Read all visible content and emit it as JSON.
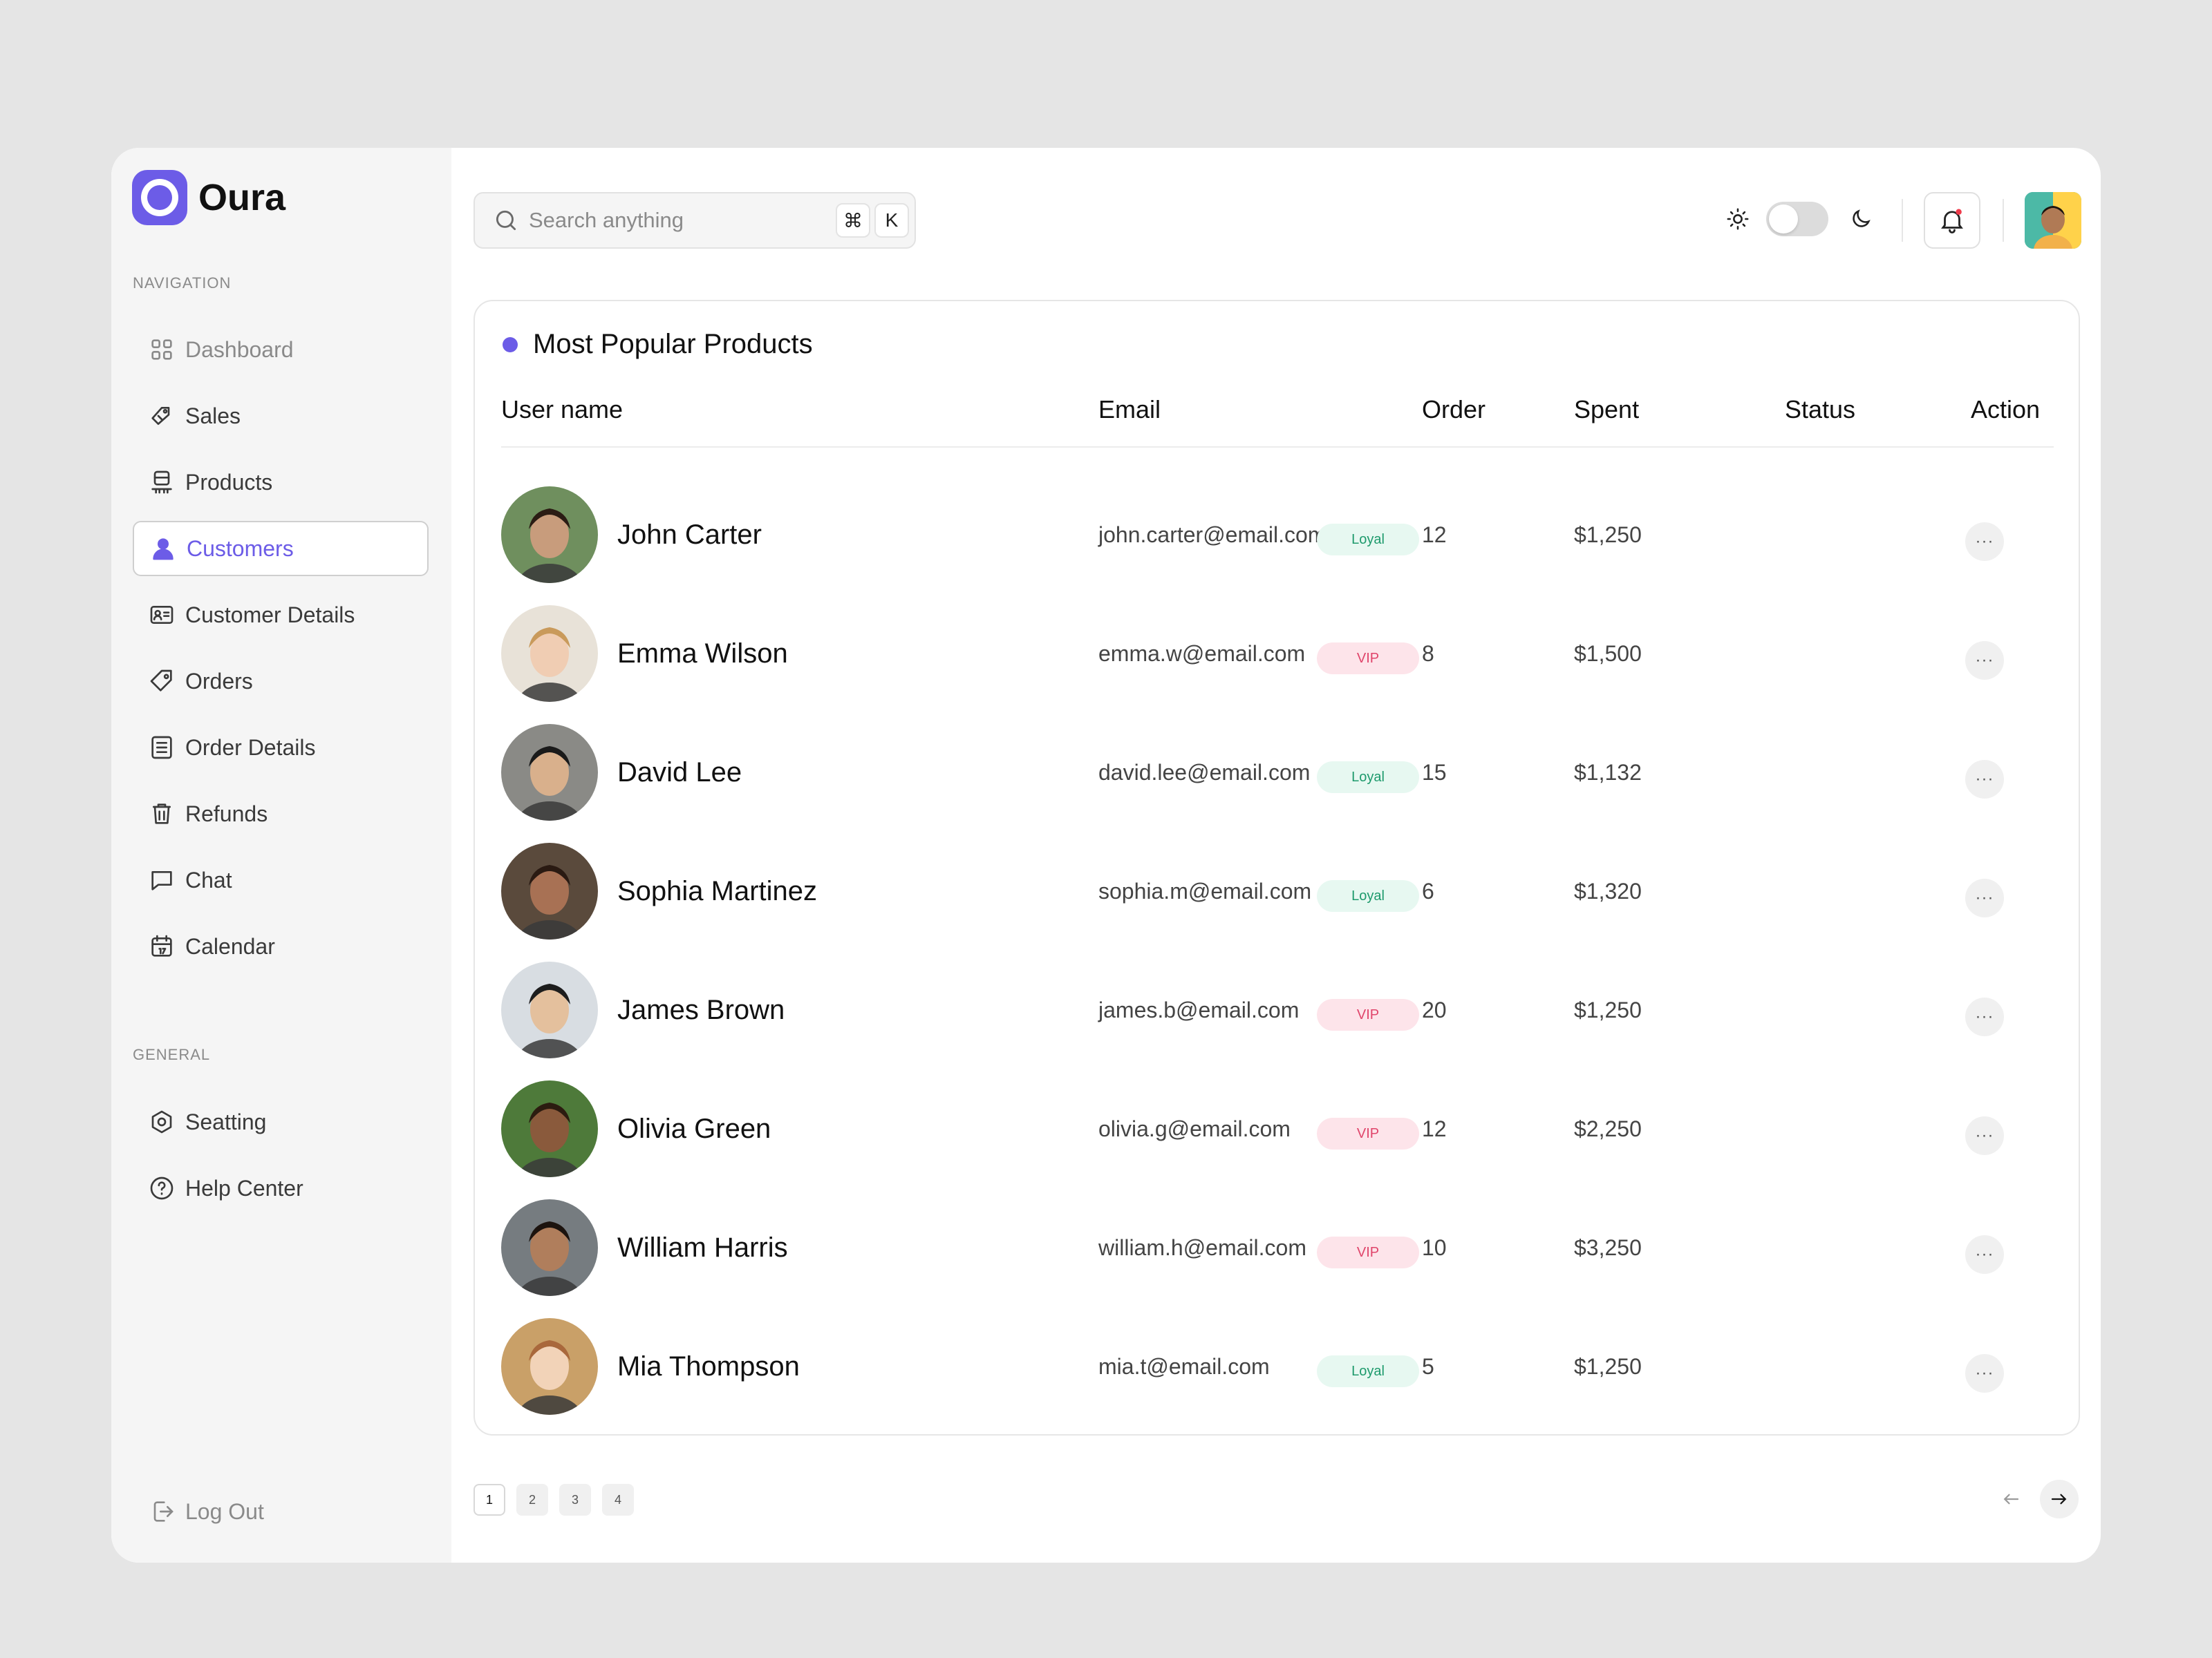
{
  "app": {
    "brand": "Oura"
  },
  "sidebar": {
    "navigation_label": "NAVIGATION",
    "nav_items": [
      {
        "label": "Dashboard",
        "icon": "grid-icon",
        "state": "muted"
      },
      {
        "label": "Sales",
        "icon": "tag-icon",
        "state": ""
      },
      {
        "label": "Products",
        "icon": "box-icon",
        "state": ""
      },
      {
        "label": "Customers",
        "icon": "user-icon",
        "state": "active"
      },
      {
        "label": "Customer Details",
        "icon": "id-card-icon",
        "state": ""
      },
      {
        "label": "Orders",
        "icon": "price-tag-icon",
        "state": ""
      },
      {
        "label": "Order Details",
        "icon": "list-icon",
        "state": ""
      },
      {
        "label": "Refunds",
        "icon": "trash-icon",
        "state": ""
      },
      {
        "label": "Chat",
        "icon": "chat-icon",
        "state": ""
      },
      {
        "label": "Calendar",
        "icon": "calendar-icon",
        "state": ""
      }
    ],
    "general_label": "GENERAL",
    "general_items": [
      {
        "label": "Seatting",
        "icon": "settings-icon"
      },
      {
        "label": "Help Center",
        "icon": "help-icon"
      }
    ],
    "logout_label": "Log Out"
  },
  "topbar": {
    "search_placeholder": "Search anything",
    "shortcut_cmd": "⌘",
    "shortcut_key": "K"
  },
  "table": {
    "title": "Most Popular Products",
    "columns": {
      "user": "User name",
      "email": "Email",
      "order": "Order",
      "spent": "Spent",
      "status": "Status",
      "action": "Action"
    },
    "rows": [
      {
        "name": "John Carter",
        "email": "john.carter@email.com",
        "order": "12",
        "spent": "$1,250",
        "status": "Loyal",
        "tone": "loyal",
        "skin": "#c89c7c",
        "hair": "#2b1c14",
        "bg": "#6f8f5e"
      },
      {
        "name": "Emma Wilson",
        "email": "emma.w@email.com",
        "order": "8",
        "spent": "$1,500",
        "status": "VIP",
        "tone": "vip",
        "skin": "#f0cdb3",
        "hair": "#c99a5b",
        "bg": "#e8e2d8"
      },
      {
        "name": "David Lee",
        "email": "david.lee@email.com",
        "order": "15",
        "spent": "$1,132",
        "status": "Loyal",
        "tone": "loyal",
        "skin": "#d9b08c",
        "hair": "#1a1a1a",
        "bg": "#8a8a86"
      },
      {
        "name": "Sophia Martinez",
        "email": "sophia.m@email.com",
        "order": "6",
        "spent": "$1,320",
        "status": "Loyal",
        "tone": "loyal",
        "skin": "#a87154",
        "hair": "#2a1a12",
        "bg": "#5a4a3c"
      },
      {
        "name": "James Brown",
        "email": "james.b@email.com",
        "order": "20",
        "spent": "$1,250",
        "status": "VIP",
        "tone": "vip",
        "skin": "#e4c09d",
        "hair": "#1d1d1d",
        "bg": "#d8dde2"
      },
      {
        "name": "Olivia Green",
        "email": "olivia.g@email.com",
        "order": "12",
        "spent": "$2,250",
        "status": "VIP",
        "tone": "vip",
        "skin": "#8a5a3c",
        "hair": "#2c1c10",
        "bg": "#4e7a3a"
      },
      {
        "name": "William Harris",
        "email": "william.h@email.com",
        "order": "10",
        "spent": "$3,250",
        "status": "VIP",
        "tone": "vip",
        "skin": "#b07e5c",
        "hair": "#1c130e",
        "bg": "#767c80"
      },
      {
        "name": "Mia Thompson",
        "email": "mia.t@email.com",
        "order": "5",
        "spent": "$1,250",
        "status": "Loyal",
        "tone": "loyal",
        "skin": "#f2d3b8",
        "hair": "#a9683c",
        "bg": "#c9a068"
      }
    ]
  },
  "pagination": {
    "pages": [
      "1",
      "2",
      "3",
      "4"
    ],
    "current": "1"
  },
  "colors": {
    "accent": "#6c5ce7",
    "loyal": "#1d9a6c",
    "vip": "#e0456b"
  }
}
